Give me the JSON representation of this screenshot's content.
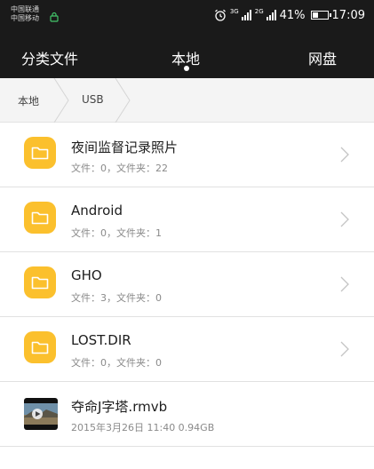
{
  "status_bar": {
    "carrier_1": "中国联通",
    "carrier_2": "中国移动",
    "net_1": "3G",
    "net_2": "2G",
    "battery": "41%",
    "battery_level": 0.41,
    "time": "17:09",
    "icons": [
      "alarm-icon",
      "signal-icon",
      "battery-icon"
    ]
  },
  "tabs": {
    "category": "分类文件",
    "local": "本地",
    "cloud": "网盘",
    "active": "local"
  },
  "breadcrumb": {
    "items": [
      "本地",
      "USB"
    ]
  },
  "files": [
    {
      "name": "夜间监督记录照片",
      "meta": "文件：0，文件夹：22",
      "type": "folder"
    },
    {
      "name": "Android",
      "meta": "文件：0，文件夹：1",
      "type": "folder"
    },
    {
      "name": "GHO",
      "meta": "文件：3，文件夹：0",
      "type": "folder"
    },
    {
      "name": "LOST.DIR",
      "meta": "文件：0，文件夹：0",
      "type": "folder"
    },
    {
      "name": "夺命J字塔.rmvb",
      "meta": "2015年3月26日 11:40 0.94GB",
      "type": "video"
    }
  ],
  "colors": {
    "header_bg": "#1a1a1a",
    "folder": "#fbc02d",
    "breadcrumb_bg": "#f4f4f4"
  }
}
